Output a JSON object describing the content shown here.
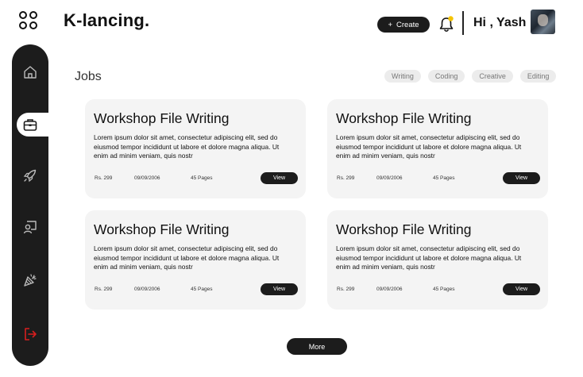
{
  "header": {
    "brand": "K-lancing.",
    "create_label": "Create",
    "create_icon": "+",
    "greeting": "Hi , Yash"
  },
  "sidebar": {
    "items": [
      {
        "icon": "home-icon"
      },
      {
        "icon": "briefcase-icon",
        "active": true
      },
      {
        "icon": "rocket-icon"
      },
      {
        "icon": "user-board-icon"
      },
      {
        "icon": "party-popper-icon"
      },
      {
        "icon": "logout-icon"
      }
    ]
  },
  "main": {
    "title": "Jobs",
    "filters": [
      "Writing",
      "Coding",
      "Creative",
      "Editing"
    ],
    "cards": [
      {
        "title": "Workshop File Writing",
        "description": "Lorem ipsum dolor sit amet, consectetur adipiscing elit, sed do eiusmod tempor incididunt ut labore et dolore magna aliqua. Ut enim ad minim veniam, quis nostr",
        "price": "Rs. 299",
        "date": "09/09/2006",
        "pages": "45 Pages",
        "view_label": "View"
      },
      {
        "title": "Workshop File Writing",
        "description": "Lorem ipsum dolor sit amet, consectetur adipiscing elit, sed do eiusmod tempor incididunt ut labore et dolore magna aliqua. Ut enim ad minim veniam, quis nostr",
        "price": "Rs. 299",
        "date": "09/09/2006",
        "pages": "45 Pages",
        "view_label": "View"
      },
      {
        "title": "Workshop File Writing",
        "description": "Lorem ipsum dolor sit amet, consectetur adipiscing elit, sed do eiusmod tempor incididunt ut labore et dolore magna aliqua. Ut enim ad minim veniam, quis nostr",
        "price": "Rs. 299",
        "date": "09/09/2006",
        "pages": "45 Pages",
        "view_label": "View"
      },
      {
        "title": "Workshop File Writing",
        "description": "Lorem ipsum dolor sit amet, consectetur adipiscing elit, sed do eiusmod tempor incididunt ut labore et dolore magna aliqua. Ut enim ad minim veniam, quis nostr",
        "price": "Rs. 299",
        "date": "09/09/2006",
        "pages": "45 Pages",
        "view_label": "View"
      }
    ],
    "more_label": "More"
  },
  "colors": {
    "dark": "#1c1c1c",
    "card_bg": "#f4f4f4",
    "chip_bg": "#ececec",
    "logout": "#d81e1e",
    "notification_dot": "#f5c400"
  }
}
